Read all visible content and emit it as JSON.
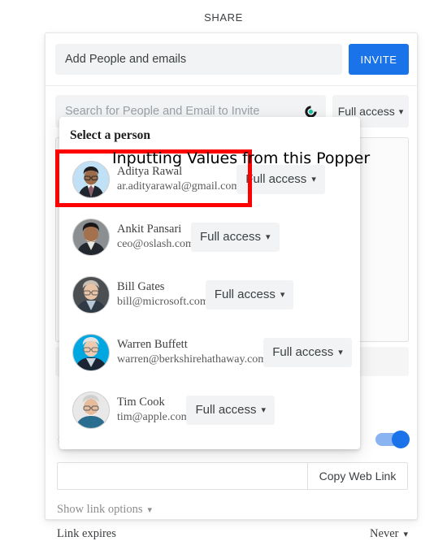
{
  "page": {
    "title": "SHARE",
    "background": "#ffffff",
    "accent_color": "#1a73e8",
    "annotation_color": "#fe0000"
  },
  "invite": {
    "input_value": "Add People and emails",
    "placeholder": "Add People and emails",
    "button_label": "INVITE"
  },
  "search": {
    "placeholder": "Search for People and Email to Invite",
    "spinner_icon": "loading-spinner-icon",
    "spinner_color": "#12c2a0",
    "access_value": "Full access",
    "caret_icon": "chevron-down-icon"
  },
  "link_sharing": {
    "globe_icon": "globe-icon",
    "row_label": "",
    "toggle_on": true,
    "url_value": "",
    "copy_button_label": "Copy Web Link",
    "show_options_label": "Show link options",
    "expires_label": "Link expires",
    "expires_value": "Never"
  },
  "popper": {
    "title": "Select a person",
    "people": [
      {
        "name": "Aditya Rawal",
        "email": "ar.adityarawal@gmail.com",
        "access": "Full access",
        "avatar_icon": "avatar-aditya-rawal",
        "avatar_bg": "#bfe0f5"
      },
      {
        "name": "Ankit Pansari",
        "email": "ceo@oslash.com",
        "access": "Full access",
        "avatar_icon": "avatar-ankit-pansari",
        "avatar_bg": "#8d8d8d"
      },
      {
        "name": "Bill Gates",
        "email": "bill@microsoft.com",
        "access": "Full access",
        "avatar_icon": "avatar-bill-gates",
        "avatar_bg": "#4a4a4a"
      },
      {
        "name": "Warren Buffett",
        "email": "warren@berkshirehathaway.com",
        "access": "Full access",
        "avatar_icon": "avatar-warren-buffett",
        "avatar_bg": "#00a7e1"
      },
      {
        "name": "Tim Cook",
        "email": "tim@apple.com",
        "access": "Full access",
        "avatar_icon": "avatar-tim-cook",
        "avatar_bg": "#e6e6e6"
      }
    ]
  },
  "annotation": {
    "text": "Inputting Values from this Popper"
  }
}
